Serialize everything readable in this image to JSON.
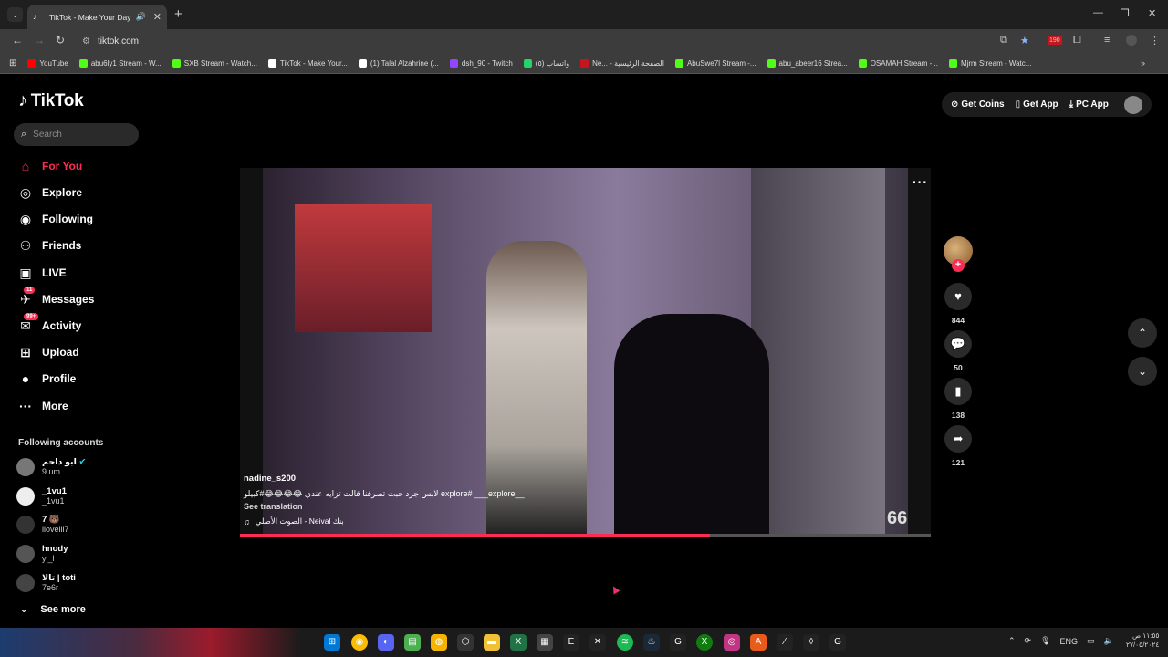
{
  "browser": {
    "tab_title": "TikTok - Make Your Day",
    "url": "tiktok.com",
    "bookmarks": [
      {
        "label": "YouTube",
        "color": "#ff0000"
      },
      {
        "label": "abu6ly1 Stream - W...",
        "color": "#53fc18"
      },
      {
        "label": "SXB Stream - Watch...",
        "color": "#53fc18"
      },
      {
        "label": "TikTok - Make Your...",
        "color": "#ffffff"
      },
      {
        "label": "(1) Talal Alzahrine (...",
        "color": "#ffffff"
      },
      {
        "label": "dsh_90 - Twitch",
        "color": "#9146ff"
      },
      {
        "label": "واتساب (٥)",
        "color": "#25d366"
      },
      {
        "label": "Ne... - الصفحة الرئيسية",
        "color": "#c4161c"
      },
      {
        "label": "AbuSwe7l Stream -...",
        "color": "#53fc18"
      },
      {
        "label": "abu_abeer16 Strea...",
        "color": "#53fc18"
      },
      {
        "label": "OSAMAH Stream -...",
        "color": "#53fc18"
      },
      {
        "label": "Mjrm Stream - Watc...",
        "color": "#53fc18"
      }
    ],
    "ext_badge": "190"
  },
  "tiktok": {
    "logo": "TikTok",
    "search_placeholder": "Search",
    "nav": [
      {
        "label": "For You",
        "icon": "home-icon",
        "glyph": "⌂"
      },
      {
        "label": "Explore",
        "icon": "compass-icon",
        "glyph": "◎"
      },
      {
        "label": "Following",
        "icon": "following-icon",
        "glyph": "◉"
      },
      {
        "label": "Friends",
        "icon": "friends-icon",
        "glyph": "⚇"
      },
      {
        "label": "LIVE",
        "icon": "live-icon",
        "glyph": "▣"
      },
      {
        "label": "Messages",
        "icon": "messages-icon",
        "glyph": "✈",
        "badge": "11"
      },
      {
        "label": "Activity",
        "icon": "activity-icon",
        "glyph": "✉",
        "badge": "99+"
      },
      {
        "label": "Upload",
        "icon": "upload-icon",
        "glyph": "⊞"
      },
      {
        "label": "Profile",
        "icon": "profile-icon",
        "glyph": "●"
      },
      {
        "label": "More",
        "icon": "more-icon",
        "glyph": "···"
      }
    ],
    "following_title": "Following accounts",
    "accounts": [
      {
        "name": "ابو داحم",
        "handle": "9.um",
        "verified": true,
        "color": "#777"
      },
      {
        "name": "_1vu1",
        "handle": "_1vu1",
        "verified": false,
        "color": "#eee"
      },
      {
        "name": "7 🐻",
        "handle": "lloveiil7",
        "verified": false,
        "color": "#333"
      },
      {
        "name": "hnody",
        "handle": "yi_l",
        "verified": false,
        "color": "#555"
      },
      {
        "name": "تالا | toti",
        "handle": "7e6r",
        "verified": false,
        "color": "#444"
      }
    ],
    "see_more": "See more",
    "top_actions": [
      "Get Coins",
      "Get App",
      "PC App"
    ],
    "video": {
      "username": "nadine_s200",
      "caption": "لابس جرد حبت تصرفنا قالت تزايه عندي 😂😂😂😂#كبيلو explore# ___explore__",
      "see_translation": "See translation",
      "music": "الصوت الأصلي - Neival بنك",
      "watermark": "66",
      "progress": 0.68
    },
    "actions": {
      "likes": "844",
      "comments": "50",
      "saves": "138",
      "shares": "121"
    }
  },
  "taskbar": {
    "lang": "ENG",
    "time": "١١:٥٥ ص",
    "date": "٢٧/٠٥/٢٠٢٤"
  }
}
